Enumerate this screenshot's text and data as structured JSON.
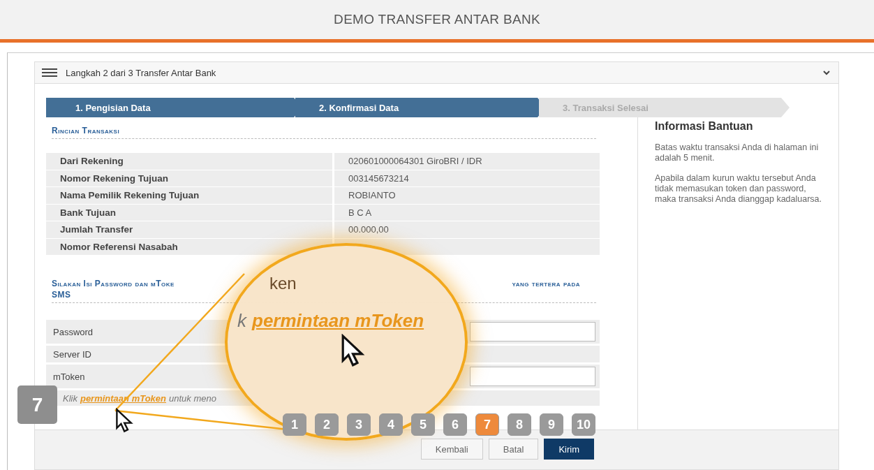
{
  "page_title": "DEMO TRANSFER ANTAR BANK",
  "menu_bar": {
    "title": "Langkah 2 dari 3 Transfer Antar Bank"
  },
  "steps": [
    {
      "label": "1. Pengisian Data",
      "completed": true
    },
    {
      "label": "2. Konfirmasi Data",
      "completed": true
    },
    {
      "label": "3. Transaksi Selesai",
      "completed": false
    }
  ],
  "details": {
    "heading": "Rincian Transaksi",
    "rows": [
      {
        "label": "Dari Rekening",
        "value": "020601000064301 GiroBRI / IDR"
      },
      {
        "label": "Nomor Rekening Tujuan",
        "value": "003145673214"
      },
      {
        "label": "Nama Pemilik Rekening Tujuan",
        "value": "ROBIANTO"
      },
      {
        "label": "Bank Tujuan",
        "value": "B C A"
      },
      {
        "label": "Jumlah Transfer",
        "value": "00.000,00"
      },
      {
        "label": "Nomor Referensi Nasabah",
        "value": ""
      }
    ]
  },
  "auth": {
    "heading_start": "Silakan Isi Password dan mToke",
    "heading_end": "yang tertera pada",
    "heading_line2": "SMS",
    "fields": [
      {
        "label": "Password",
        "kind": "input"
      },
      {
        "label": "Server ID",
        "kind": "text"
      },
      {
        "label": "mToken",
        "kind": "input"
      }
    ],
    "hint": {
      "prefix": "Klik",
      "link": "permintaan mToken",
      "suffix": "untuk meno"
    }
  },
  "help": {
    "title": "Informasi Bantuan",
    "paragraphs": [
      "Batas waktu transaksi Anda di halaman ini adalah 5 menit.",
      "Apabila dalam kurun waktu tersebut Anda tidak memasukan token dan password, maka transaksi Anda dianggap kadaluarsa."
    ]
  },
  "buttons": [
    {
      "label": "Kembali",
      "kind": "secondary"
    },
    {
      "label": "Batal",
      "kind": "secondary"
    },
    {
      "label": "Kirim",
      "kind": "primary"
    }
  ],
  "tutorial": {
    "step_badge": "7",
    "lens": {
      "heading_fragment": "ken",
      "prefix": "k",
      "link": "permintaan mToken"
    },
    "pages": [
      {
        "label": "1",
        "selected": false
      },
      {
        "label": "2",
        "selected": false
      },
      {
        "label": "3",
        "selected": false
      },
      {
        "label": "4",
        "selected": false
      },
      {
        "label": "5",
        "selected": false
      },
      {
        "label": "6",
        "selected": false
      },
      {
        "label": "7",
        "selected": true
      },
      {
        "label": "8",
        "selected": false
      },
      {
        "label": "9",
        "selected": false
      },
      {
        "label": "10",
        "selected": false
      }
    ]
  }
}
